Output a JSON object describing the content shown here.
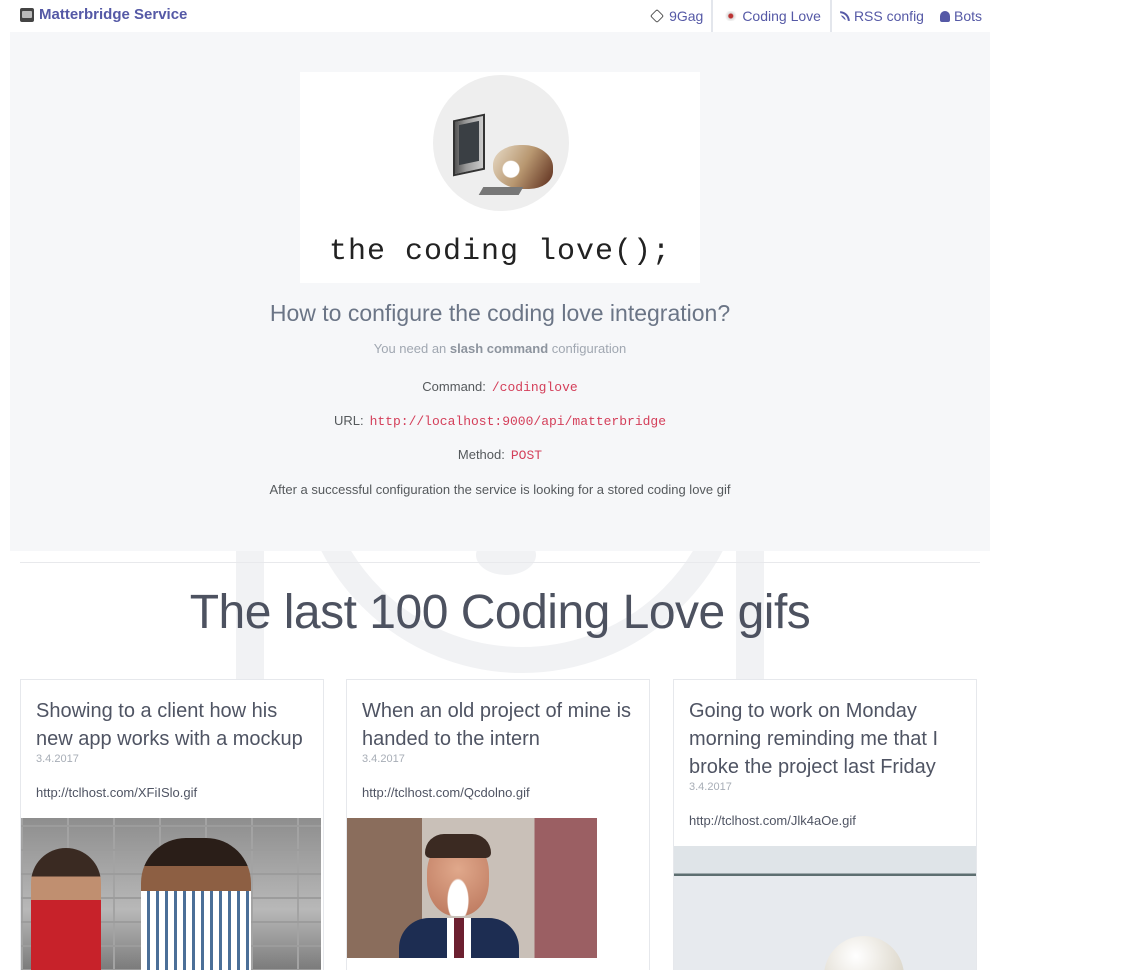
{
  "navbar": {
    "brand": "Matterbridge Service",
    "links": [
      {
        "label": "9Gag",
        "icon": "9gag-icon"
      },
      {
        "label": "Coding Love",
        "icon": "coding-love-icon",
        "active": true
      },
      {
        "label": "RSS config",
        "icon": "rss-icon"
      },
      {
        "label": "Bots",
        "icon": "android-icon"
      }
    ]
  },
  "jumbotron": {
    "logo_text": "the coding love();",
    "title": "How to configure the coding love integration?",
    "lead_prefix": "You need an",
    "lead_bold": "slash command",
    "lead_suffix": "configuration",
    "command_label": "Command:",
    "command_value": "/codinglove",
    "url_label": "URL:",
    "url_value": "http://localhost:9000/api/matterbridge",
    "method_label": "Method:",
    "method_value": "POST",
    "note": "After a successful configuration the service is looking for a stored coding love gif"
  },
  "section": {
    "title": "The last 100 Coding Love gifs"
  },
  "cards": [
    {
      "title": "Showing to a client how his new app works with a mockup",
      "date": "3.4.2017",
      "url": "http://tclhost.com/XFiISlo.gif"
    },
    {
      "title": "When an old project of mine is handed to the intern",
      "date": "3.4.2017",
      "url": "http://tclhost.com/Qcdolno.gif"
    },
    {
      "title": "Going to work on Monday morning reminding me that I broke the project last Friday",
      "date": "3.4.2017",
      "url": "http://tclhost.com/Jlk4aOe.gif"
    }
  ],
  "colors": {
    "brand": "#5559a6",
    "code": "#d43f5a",
    "jumbotron_bg": "#f6f7f9"
  }
}
